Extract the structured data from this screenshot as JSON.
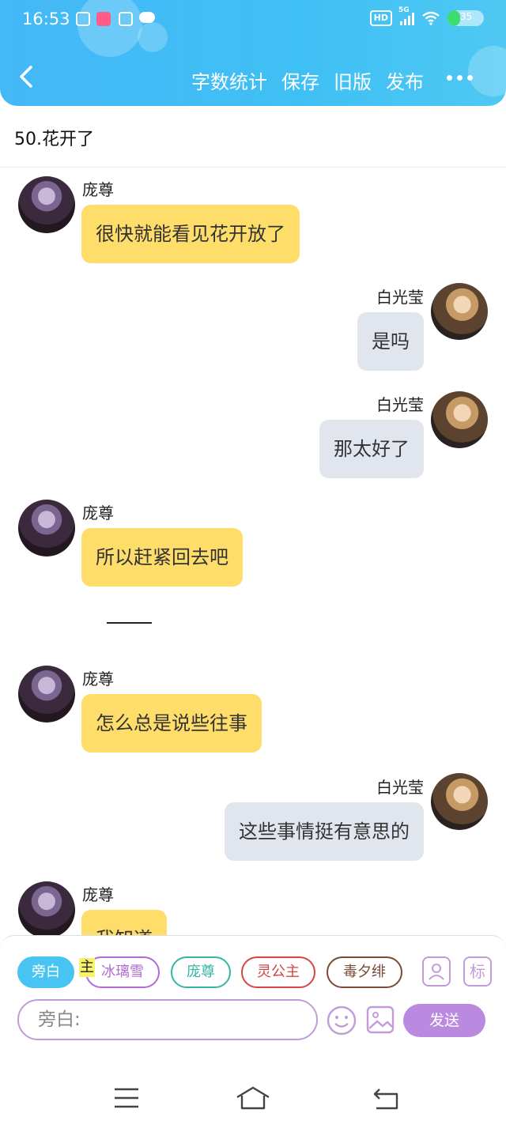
{
  "status_bar": {
    "time": "16:53",
    "hd": "HD",
    "network": "5G",
    "battery": "35",
    "battery_level": 0.35
  },
  "toolbar": {
    "word_count": "字数统计",
    "save": "保存",
    "old_version": "旧版",
    "publish": "发布"
  },
  "chapter_title": "50.花开了",
  "messages": [
    {
      "side": "left",
      "sender": "庞尊",
      "text": "很快就能看见花开放了"
    },
    {
      "side": "right",
      "sender": "白光莹",
      "text": "是吗"
    },
    {
      "side": "right",
      "sender": "白光莹",
      "text": "那太好了"
    },
    {
      "side": "left",
      "sender": "庞尊",
      "text": "所以赶紧回去吧"
    },
    {
      "side": "left",
      "sender": "庞尊",
      "text": "怎么总是说些往事"
    },
    {
      "side": "right",
      "sender": "白光莹",
      "text": "这些事情挺有意思的"
    },
    {
      "side": "left",
      "sender": "庞尊",
      "text": "我知道"
    }
  ],
  "characters": {
    "narrator": "旁白",
    "main_mark": "主",
    "c1": "冰璃雪",
    "c2": "庞尊",
    "c3": "灵公主",
    "c4": "毒夕绯"
  },
  "tools": {
    "mark_label": "标"
  },
  "composer": {
    "placeholder": "旁白:",
    "send": "发送"
  }
}
